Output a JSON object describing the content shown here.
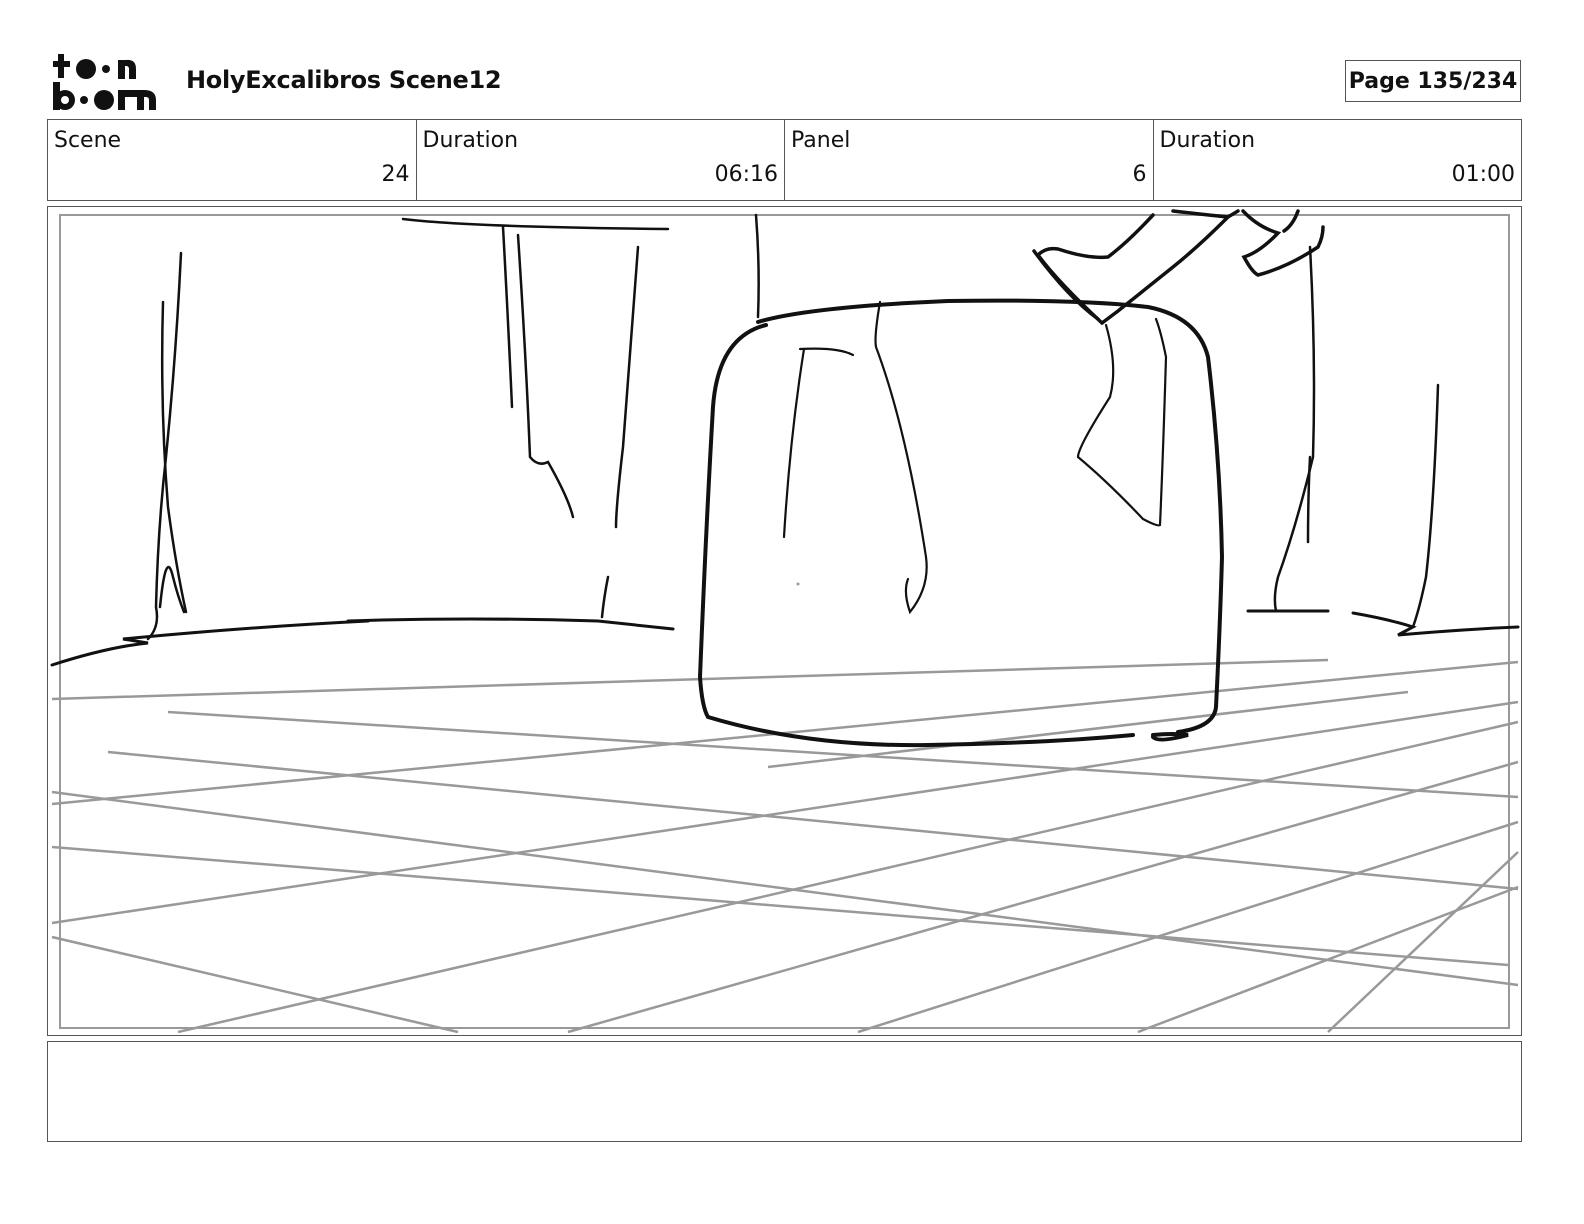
{
  "header": {
    "logo_text": "toon boom",
    "title": "HolyExcalibros Scene12",
    "page": "Page 135/234"
  },
  "info": {
    "scene_label": "Scene",
    "scene_value": "24",
    "scene_duration_label": "Duration",
    "scene_duration_value": "06:16",
    "panel_label": "Panel",
    "panel_value": "6",
    "panel_duration_label": "Duration",
    "panel_duration_value": "01:00"
  },
  "panel": {
    "drawing": "storyboard-sketch"
  },
  "caption": {
    "text": ""
  }
}
